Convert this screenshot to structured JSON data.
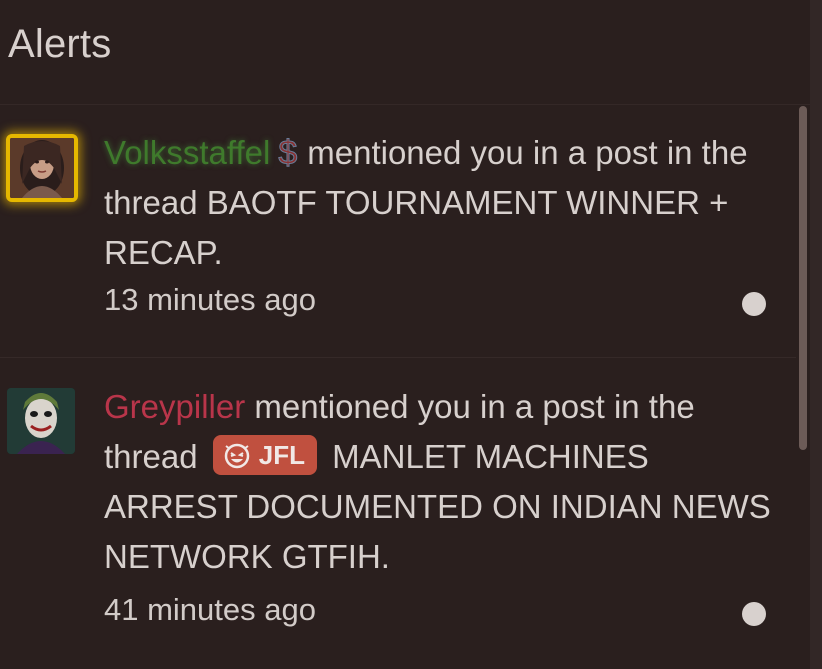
{
  "header": {
    "title": "Alerts"
  },
  "alerts": [
    {
      "username": "Volksstaffel",
      "badge_icon": "dollar-icon",
      "badge_symbol": "$",
      "text": "mentioned you in a post in the thread BAOTF TOURNAMENT WINNER + RECAP.",
      "time": "13 minutes ago",
      "unread": true
    },
    {
      "username": "Greypiller",
      "text_before": "mentioned you in a post in the thread",
      "prefix_label": "JFL",
      "prefix_icon": "laughing-emoji-icon",
      "text_after": "MANLET MACHINES ARREST DOCUMENTED ON INDIAN NEWS NETWORK GTFIH.",
      "time": "41 minutes ago",
      "unread": true
    }
  ],
  "colors": {
    "background": "#2a1f1e",
    "username_1": "#3f7a2c",
    "username_2": "#b9354a",
    "prefix_bg": "#c0503f",
    "avatar_border": "#e6b800"
  }
}
